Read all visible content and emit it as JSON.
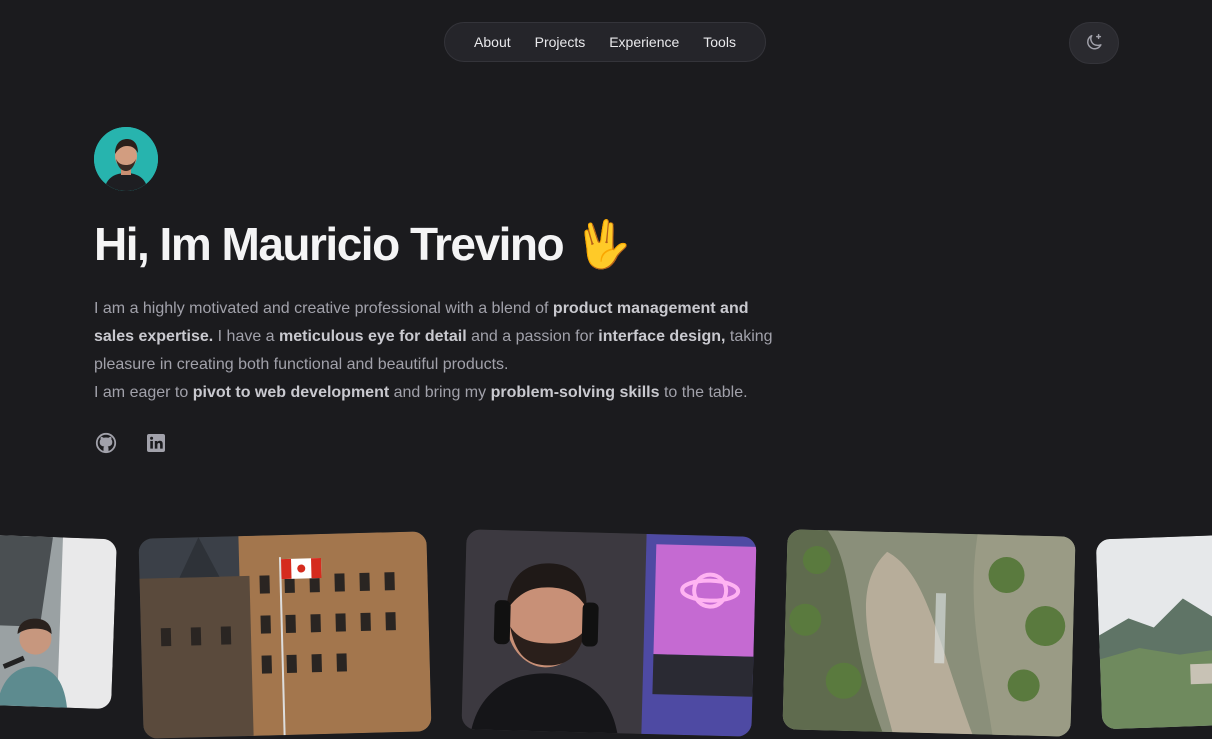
{
  "nav": {
    "items": [
      {
        "label": "About"
      },
      {
        "label": "Projects"
      },
      {
        "label": "Experience"
      },
      {
        "label": "Tools"
      }
    ]
  },
  "theme_toggle": {
    "icon": "moon-sparkle-icon"
  },
  "hero": {
    "name_line": "Hi, Im Mauricio Trevino",
    "emoji": "🖖",
    "intro": {
      "p1_a": "I am a highly motivated and creative professional with a blend of ",
      "p1_b": "product management and sales expertise.",
      "p1_c": " I have a ",
      "p1_d": "meticulous eye for detail",
      "p1_e": " and a passion for ",
      "p1_f": "interface design,",
      "p1_g": " taking pleasure in creating both functional and beautiful products.",
      "p2_a": "I am eager to ",
      "p2_b": "pivot to web development",
      "p2_c": " and bring my ",
      "p2_d": "problem-solving skills",
      "p2_e": " to the table."
    }
  },
  "socials": [
    {
      "icon": "github-icon"
    },
    {
      "icon": "linkedin-icon"
    }
  ],
  "photos": [
    {
      "subject": "speaker-on-stage"
    },
    {
      "subject": "historic-building-canada-flag"
    },
    {
      "subject": "man-with-headphones-neon-planet"
    },
    {
      "subject": "rocky-cliff-waterfall"
    },
    {
      "subject": "mountains-landscape"
    }
  ],
  "colors": {
    "background": "#1b1b1e",
    "text": "#f4f4f5",
    "muted": "#a1a1aa"
  }
}
